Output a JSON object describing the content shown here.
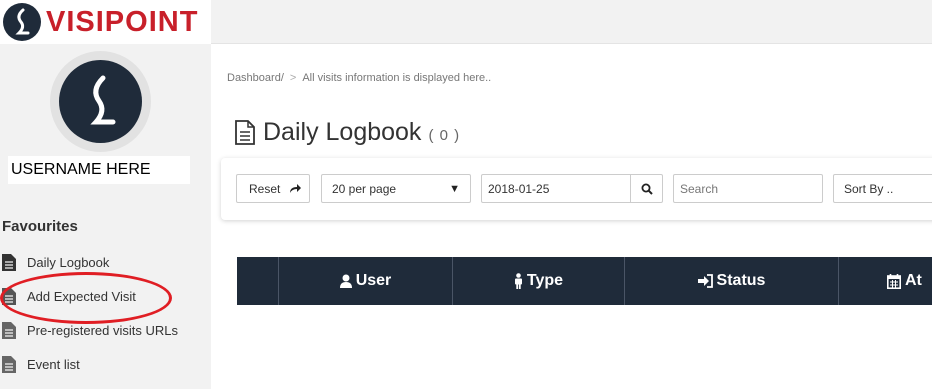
{
  "brand": {
    "name": "VISIPOINT",
    "logo_color": "#c8202a"
  },
  "sidebar": {
    "username": "USERNAME HERE",
    "favourites_heading": "Favourites",
    "items": [
      {
        "label": "Daily Logbook",
        "icon": "document-icon"
      },
      {
        "label": "Add Expected Visit",
        "icon": "document-icon"
      },
      {
        "label": "Pre-registered visits URLs",
        "icon": "document-icon"
      },
      {
        "label": "Event list",
        "icon": "document-icon"
      }
    ]
  },
  "breadcrumb": {
    "root": "Dashboard/",
    "separator": ">",
    "description": "All visits information is displayed here.."
  },
  "page": {
    "title": "Daily Logbook",
    "count": "( 0 )"
  },
  "toolbar": {
    "reset_label": "Reset",
    "per_page_value": "20 per page",
    "date_value": "2018-01-25",
    "search_placeholder": "Search",
    "sort_label": "Sort By .."
  },
  "table": {
    "columns": [
      {
        "label": "",
        "icon": ""
      },
      {
        "label": "User",
        "icon": "user-icon"
      },
      {
        "label": "Type",
        "icon": "person-icon"
      },
      {
        "label": "Status",
        "icon": "sign-in-icon"
      },
      {
        "label": "At",
        "icon": "calendar-icon"
      }
    ]
  },
  "colors": {
    "table_header": "#1f2b3a",
    "annotation": "#e01e24"
  }
}
